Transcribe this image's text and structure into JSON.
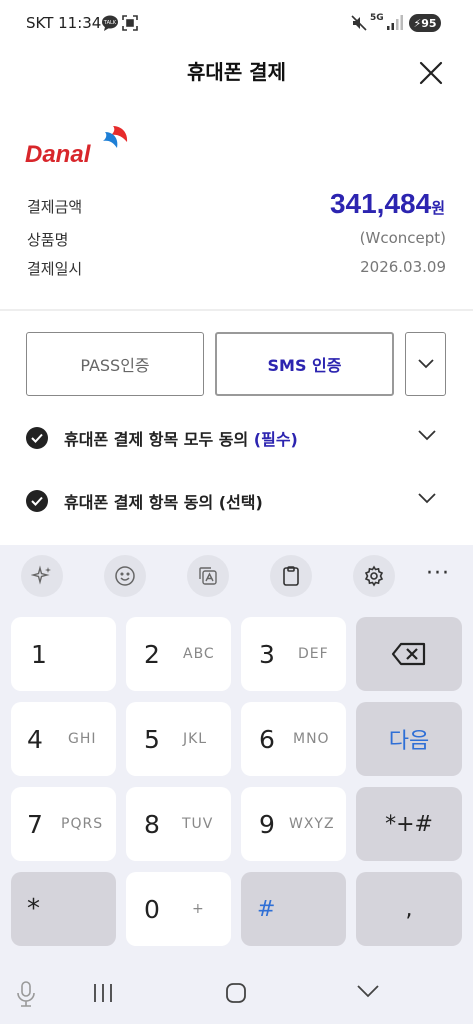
{
  "status_bar": {
    "carrier_time": "SKT 11:34",
    "talk": "TALK",
    "net": "5G",
    "battery": "95"
  },
  "header": {
    "title": "휴대폰 결제"
  },
  "merchant": {
    "logo_text": "Danal"
  },
  "payment": {
    "amount_label": "결제금액",
    "amount_value": "341,484",
    "amount_unit": "원",
    "product_label": "상품명",
    "product_value": "(Wconcept)",
    "date_label": "결제일시",
    "date_value": "2026.03.09"
  },
  "auth": {
    "pass_label": "PASS인증",
    "sms_label": "SMS 인증"
  },
  "agreements": [
    {
      "text": "휴대폰 결제 항목 모두 동의 ",
      "tag": "(필수)"
    },
    {
      "text": "휴대폰 결제 항목 동의 (선택)"
    }
  ],
  "keyboard": {
    "toolbar_more": "···",
    "keys": {
      "k1": "1",
      "k2": "2",
      "k2l": "ABC",
      "k3": "3",
      "k3l": "DEF",
      "k4": "4",
      "k4l": "GHI",
      "k5": "5",
      "k5l": "JKL",
      "k6": "6",
      "k6l": "MNO",
      "next": "다음",
      "k7": "7",
      "k7l": "PQRS",
      "k8": "8",
      "k8l": "TUV",
      "k9": "9",
      "k9l": "WXYZ",
      "sym": "*+#",
      "star": "*",
      "k0": "0",
      "k0l": "+",
      "hash": "#",
      "comma": ","
    }
  },
  "colors": {
    "accent": "#2c24b0",
    "keyboard_bg": "#eff0f7",
    "key_gray": "#d5d4db",
    "link_blue": "#2f6fd6"
  }
}
